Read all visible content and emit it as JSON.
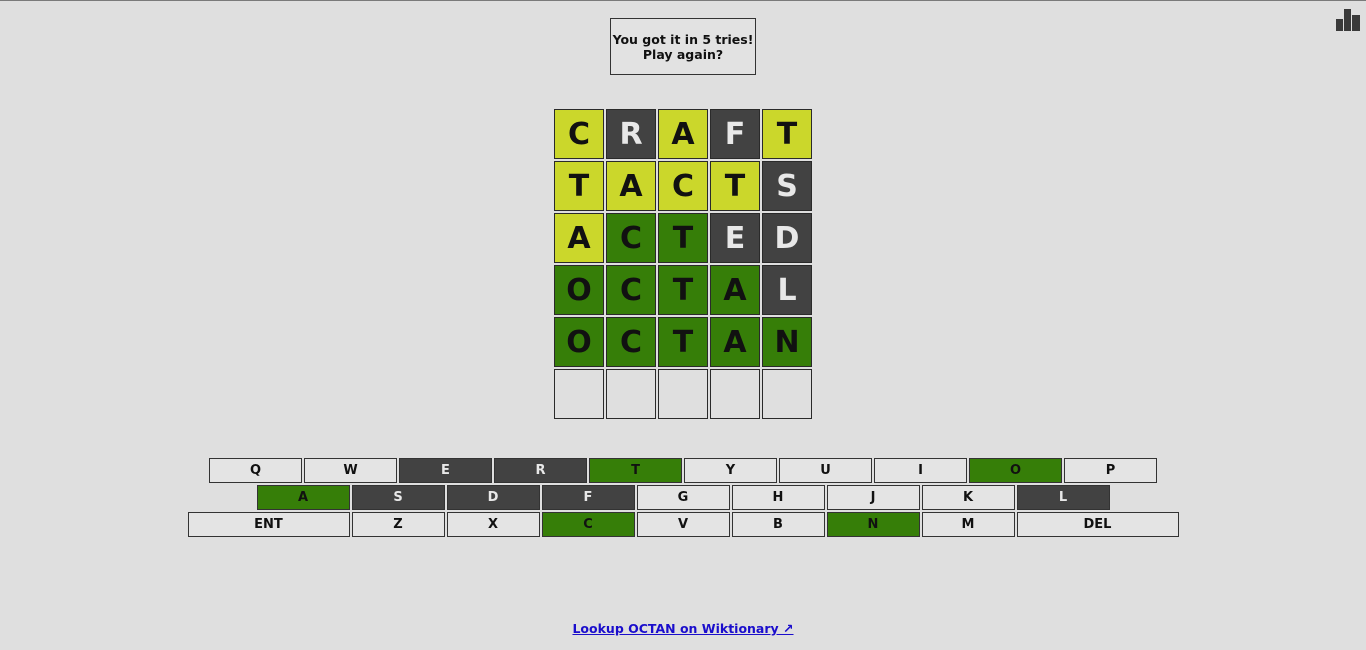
{
  "header": {
    "stats_icon": "bar-chart-icon"
  },
  "status": {
    "line1": "You got it in 5 tries!",
    "line2": "Play again?"
  },
  "colors": {
    "correct": "#367e08",
    "present": "#cbd72b",
    "absent": "#424242",
    "background": "#dfdfdf"
  },
  "board": {
    "rows": [
      [
        {
          "letter": "C",
          "state": "present"
        },
        {
          "letter": "R",
          "state": "absent"
        },
        {
          "letter": "A",
          "state": "present"
        },
        {
          "letter": "F",
          "state": "absent"
        },
        {
          "letter": "T",
          "state": "present"
        }
      ],
      [
        {
          "letter": "T",
          "state": "present"
        },
        {
          "letter": "A",
          "state": "present"
        },
        {
          "letter": "C",
          "state": "present"
        },
        {
          "letter": "T",
          "state": "present"
        },
        {
          "letter": "S",
          "state": "absent"
        }
      ],
      [
        {
          "letter": "A",
          "state": "present"
        },
        {
          "letter": "C",
          "state": "correct"
        },
        {
          "letter": "T",
          "state": "correct"
        },
        {
          "letter": "E",
          "state": "absent"
        },
        {
          "letter": "D",
          "state": "absent"
        }
      ],
      [
        {
          "letter": "O",
          "state": "correct"
        },
        {
          "letter": "C",
          "state": "correct"
        },
        {
          "letter": "T",
          "state": "correct"
        },
        {
          "letter": "A",
          "state": "correct"
        },
        {
          "letter": "L",
          "state": "absent"
        }
      ],
      [
        {
          "letter": "O",
          "state": "correct"
        },
        {
          "letter": "C",
          "state": "correct"
        },
        {
          "letter": "T",
          "state": "correct"
        },
        {
          "letter": "A",
          "state": "correct"
        },
        {
          "letter": "N",
          "state": "correct"
        }
      ],
      [
        {
          "letter": "",
          "state": "empty"
        },
        {
          "letter": "",
          "state": "empty"
        },
        {
          "letter": "",
          "state": "empty"
        },
        {
          "letter": "",
          "state": "empty"
        },
        {
          "letter": "",
          "state": "empty"
        }
      ]
    ]
  },
  "keyboard": {
    "rows": [
      [
        {
          "label": "Q",
          "state": "unused"
        },
        {
          "label": "W",
          "state": "unused"
        },
        {
          "label": "E",
          "state": "absent"
        },
        {
          "label": "R",
          "state": "absent"
        },
        {
          "label": "T",
          "state": "correct"
        },
        {
          "label": "Y",
          "state": "unused"
        },
        {
          "label": "U",
          "state": "unused"
        },
        {
          "label": "I",
          "state": "unused"
        },
        {
          "label": "O",
          "state": "correct"
        },
        {
          "label": "P",
          "state": "unused"
        }
      ],
      [
        {
          "label": "A",
          "state": "correct"
        },
        {
          "label": "S",
          "state": "absent"
        },
        {
          "label": "D",
          "state": "absent"
        },
        {
          "label": "F",
          "state": "absent"
        },
        {
          "label": "G",
          "state": "unused"
        },
        {
          "label": "H",
          "state": "unused"
        },
        {
          "label": "J",
          "state": "unused"
        },
        {
          "label": "K",
          "state": "unused"
        },
        {
          "label": "L",
          "state": "absent"
        }
      ],
      [
        {
          "label": "ENT",
          "state": "unused",
          "wide": true
        },
        {
          "label": "Z",
          "state": "unused"
        },
        {
          "label": "X",
          "state": "unused"
        },
        {
          "label": "C",
          "state": "correct"
        },
        {
          "label": "V",
          "state": "unused"
        },
        {
          "label": "B",
          "state": "unused"
        },
        {
          "label": "N",
          "state": "correct"
        },
        {
          "label": "M",
          "state": "unused"
        },
        {
          "label": "DEL",
          "state": "unused",
          "wide": true
        }
      ]
    ]
  },
  "footer": {
    "lookup_link": "Lookup OCTAN on Wiktionary ↗"
  }
}
